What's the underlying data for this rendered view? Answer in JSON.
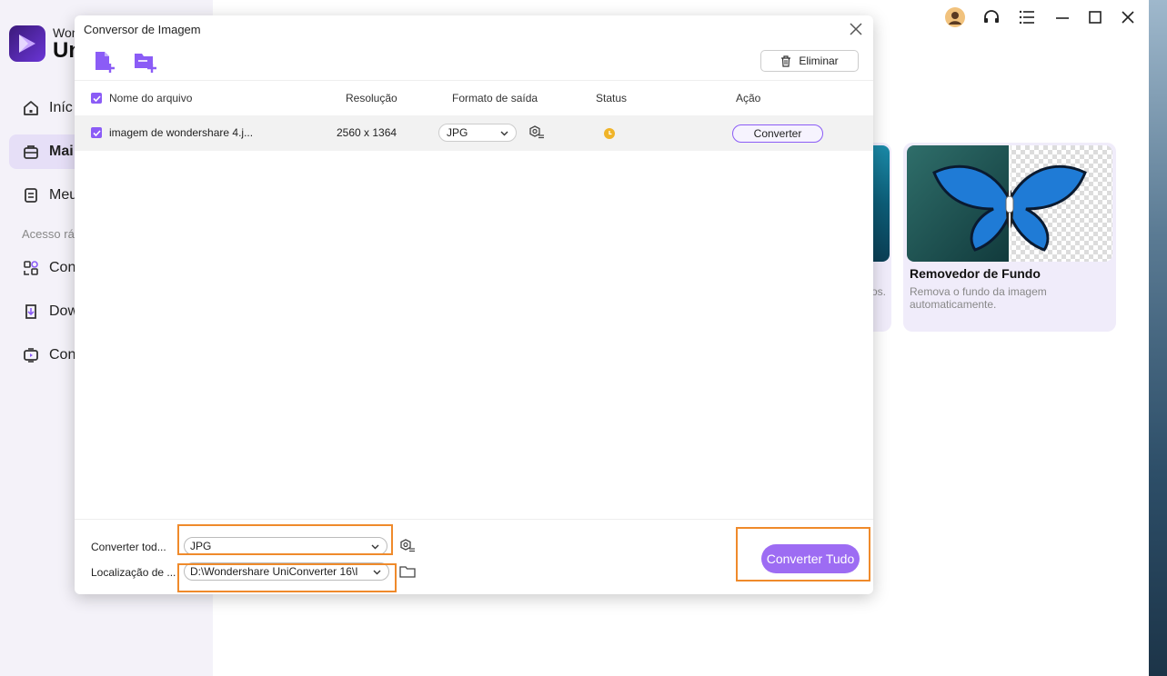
{
  "app": {
    "brand_line1": "Won",
    "brand_line2": "Un"
  },
  "sidebar": {
    "items": [
      {
        "label": "Iníc",
        "icon": "home-icon"
      },
      {
        "label": "Mai",
        "icon": "toolbox-icon"
      },
      {
        "label": "Meu",
        "icon": "file-icon"
      }
    ],
    "quick_access": "Acesso rá",
    "quick_items": [
      {
        "label": "Con",
        "icon": "convert-icon"
      },
      {
        "label": "Dow",
        "icon": "download-icon"
      },
      {
        "label": "Con",
        "icon": "screen-record-icon"
      }
    ]
  },
  "cards": {
    "partial_desc": "os.",
    "bg_remover": {
      "title": "Removedor de Fundo",
      "desc": "Remova o fundo da imagem automaticamente."
    }
  },
  "dialog": {
    "title": "Conversor de Imagem",
    "delete_label": "Eliminar",
    "columns": {
      "name": "Nome do arquivo",
      "resolution": "Resolução",
      "format": "Formato de saída",
      "status": "Status",
      "action": "Ação"
    },
    "rows": [
      {
        "name": "imagem de wondershare 4.j...",
        "resolution": "2560 x 1364",
        "format": "JPG",
        "action": "Converter"
      }
    ],
    "footer": {
      "convert_all_label": "Converter tod...",
      "convert_all_value": "JPG",
      "location_label": "Localização de ...",
      "location_value": "D:\\Wondershare UniConverter 16\\I",
      "convert_all_button": "Converter Tudo"
    }
  },
  "colors": {
    "accent": "#8b5cf6",
    "highlight": "#ef8a2b",
    "status_pending": "#f0b429"
  }
}
